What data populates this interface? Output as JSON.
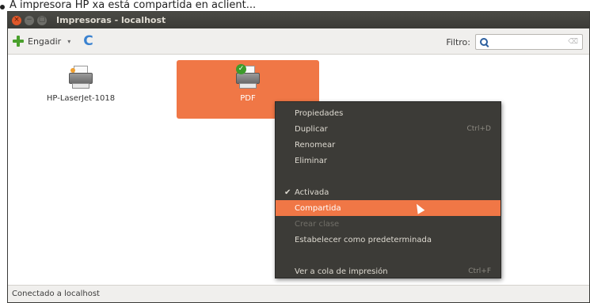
{
  "caption": "A impresora HP xa está compartida en aclient...",
  "window": {
    "title": "Impresoras - localhost",
    "buttons": {
      "close": "×",
      "minimize": "−",
      "maximize": "▢"
    }
  },
  "toolbar": {
    "add_label": "Engadir",
    "add_icon": "plus-icon",
    "dropdown_glyph": "▾",
    "refresh_glyph": "C",
    "filter_label": "Filtro:",
    "filter_value": "",
    "clear_glyph": "⌫"
  },
  "printers": [
    {
      "name": "HP-LaserJet-1018",
      "selected": false,
      "icon": "printer-icon"
    },
    {
      "name": "PDF",
      "selected": true,
      "icon": "printer-default-icon",
      "badge": "✓"
    }
  ],
  "context_menu": {
    "items": [
      {
        "label": "Propiedades",
        "accel": ""
      },
      {
        "label": "Duplicar",
        "accel": "Ctrl+D"
      },
      {
        "label": "Renomear",
        "accel": ""
      },
      {
        "label": "Eliminar",
        "accel": ""
      },
      {
        "label": "Activada",
        "accel": "",
        "checked": "✔"
      },
      {
        "label": "Compartida",
        "accel": "",
        "hover": true
      },
      {
        "label": "Crear clase",
        "accel": "",
        "disabled": true
      },
      {
        "label": "Estabelecer como predeterminada",
        "accel": ""
      },
      {
        "label": "Ver a cola de impresión",
        "accel": "Ctrl+F"
      }
    ]
  },
  "statusbar": {
    "text": "Conectado a localhost"
  },
  "colors": {
    "accent": "#f07746",
    "menu_bg": "#3c3b37",
    "titlebar": "#3b3b37",
    "toolbar_bg": "#f0efed"
  }
}
